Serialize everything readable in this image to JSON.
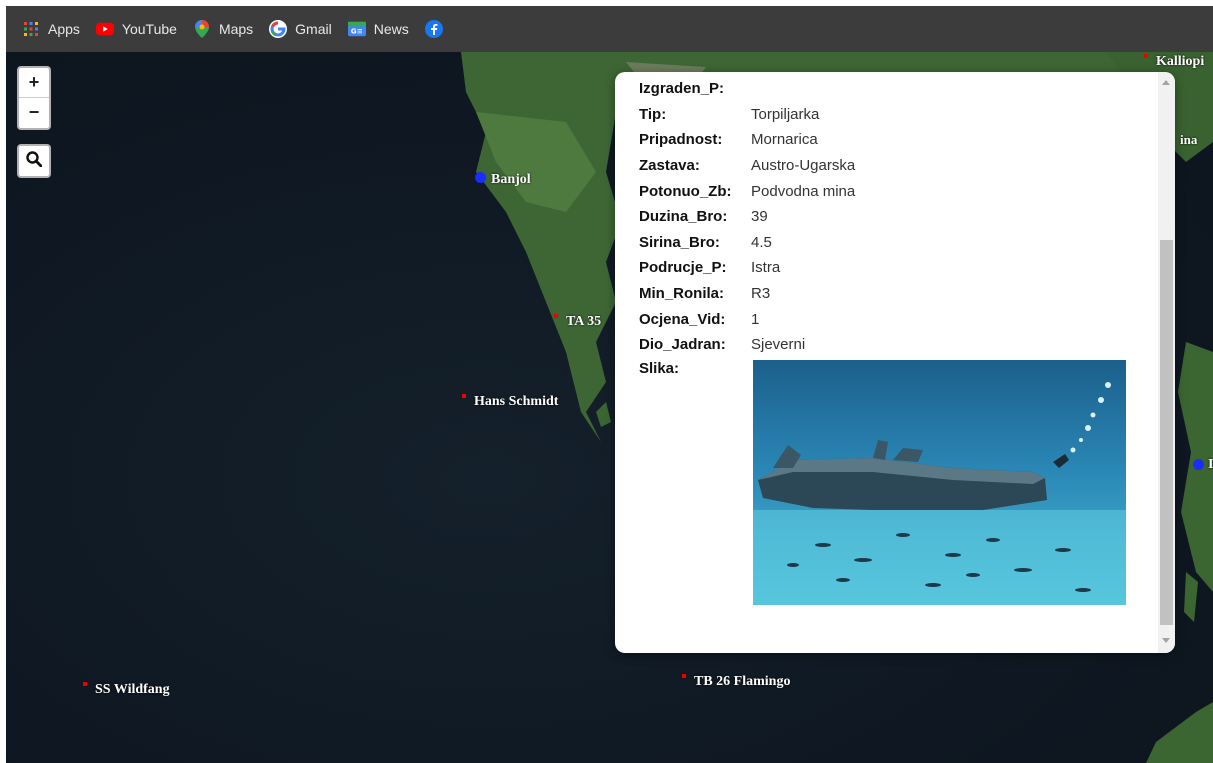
{
  "bookmarks": [
    {
      "label": "Apps",
      "icon": "apps-grid-icon"
    },
    {
      "label": "YouTube",
      "icon": "youtube-icon"
    },
    {
      "label": "Maps",
      "icon": "maps-pin-icon"
    },
    {
      "label": "Gmail",
      "icon": "google-icon"
    },
    {
      "label": "News",
      "icon": "news-icon"
    },
    {
      "label": "",
      "icon": "facebook-icon"
    }
  ],
  "map": {
    "zoom_in": "+",
    "zoom_out": "−",
    "labels": {
      "kalliopi": "Kalliopi",
      "ina": "ina",
      "banjol": "Banjol",
      "ta35": "TA 35",
      "hans_schmidt": "Hans Schmidt",
      "ss_wildfang": "SS Wildfang",
      "tb26": "TB 26 Flamingo",
      "right_edge": "I"
    }
  },
  "popup": {
    "izgraden_key": "Izgraden_P:",
    "izgraden_val": "",
    "tip_key": "Tip:",
    "tip_val": "Torpiljarka",
    "pripadnost_key": "Pripadnost:",
    "pripadnost_val": "Mornarica",
    "zastava_key": "Zastava:",
    "zastava_val": "Austro-Ugarska",
    "potonuo_key": "Potonuo_Zb:",
    "potonuo_val": "Podvodna mina",
    "duzina_key": "Duzina_Bro:",
    "duzina_val": "39",
    "sirina_key": "Sirina_Bro:",
    "sirina_val": "4.5",
    "podrucje_key": "Podrucje_P:",
    "podrucje_val": "Istra",
    "min_ronila_key": "Min_Ronila:",
    "min_ronila_val": "R3",
    "ocjena_key": "Ocjena_Vid:",
    "ocjena_val": "1",
    "dio_key": "Dio_Jadran:",
    "dio_val": "Sjeverni",
    "slika_key": "Slika:"
  },
  "colors": {
    "sea": "#101a24",
    "land": "#3f6a3a",
    "wreck_marker": "#e00000",
    "place_marker": "#1a2cff",
    "bookmark_bar": "#3c3c3c"
  }
}
